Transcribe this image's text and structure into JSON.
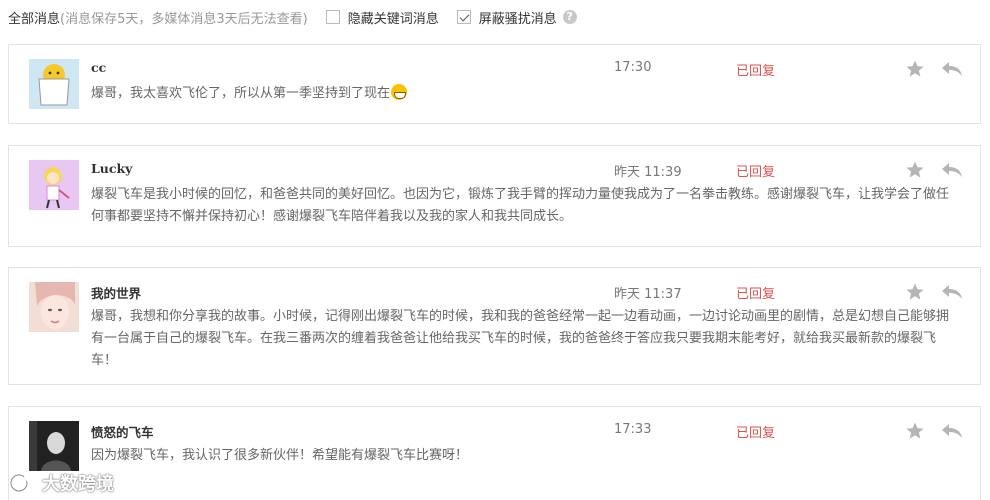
{
  "header": {
    "title": "全部消息",
    "note": "(消息保存5天，多媒体消息3天后无法查看)",
    "hide_keyword_label": "隐藏关键词消息",
    "hide_keyword_checked": false,
    "block_spam_label": "屏蔽骚扰消息",
    "block_spam_checked": true,
    "help_icon": "?"
  },
  "messages": [
    {
      "name": "cc",
      "text": "爆哥，我太喜欢飞伦了，所以从第一季坚持到了现在",
      "has_emoji": true,
      "time": "17:30",
      "status": "已回复"
    },
    {
      "name": "Lucky",
      "text": "爆裂飞车是我小时候的回忆，和爸爸共同的美好回忆。也因为它，锻炼了我手臂的挥动力量使我成为了一名拳击教练。感谢爆裂飞车，让我学会了做任何事都要坚持不懈并保持初心！感谢爆裂飞车陪伴着我以及我的家人和我共同成长。",
      "time": "昨天 11:39",
      "status": "已回复"
    },
    {
      "name": "我的世界",
      "text": "爆哥，我想和你分享我的故事。小时候，记得刚出爆裂飞车的时候，我和我的爸爸经常一起一边看动画，一边讨论动画里的剧情，总是幻想自己能够拥有一台属于自己的爆裂飞车。在我三番两次的缠着我爸爸让他给我买飞车的时候，我的爸爸终于答应我只要我期末能考好，就给我买最新款的爆裂飞车！",
      "time": "昨天 11:37",
      "status": "已回复"
    },
    {
      "name": "愤怒的飞车",
      "text": "因为爆裂飞车，我认识了很多新伙伴！希望能有爆裂飞车比赛呀！",
      "time": "17:33",
      "status": "已回复"
    }
  ],
  "watermark": "大数跨境",
  "colors": {
    "status": "#d9534f",
    "border": "#e3e3e3",
    "icon": "#b5b5b5"
  },
  "icons": {
    "star": "star-icon",
    "reply": "reply-icon",
    "emoji": "grin-emoji-icon"
  }
}
